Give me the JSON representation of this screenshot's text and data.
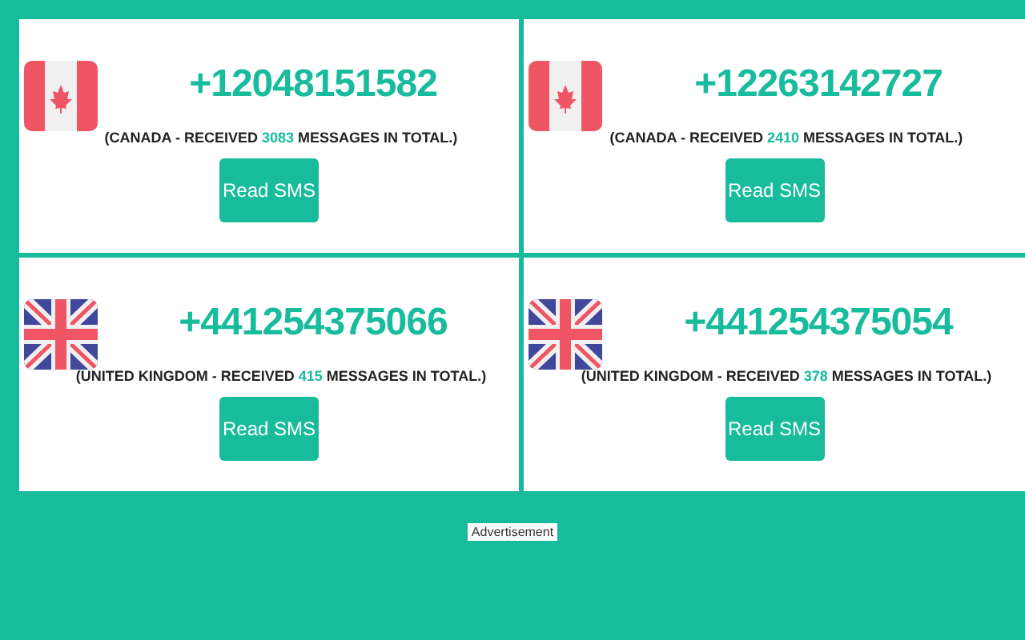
{
  "numbers": [
    {
      "kind": "ca",
      "phone": "+12048151582",
      "prefix": "(CANADA - RECEIVED ",
      "count": "3083",
      "suffix": " MESSAGES IN TOTAL.)",
      "button": "Read SMS"
    },
    {
      "kind": "ca",
      "phone": "+12263142727",
      "prefix": "(CANADA - RECEIVED ",
      "count": "2410",
      "suffix": " MESSAGES IN TOTAL.)",
      "button": "Read SMS"
    },
    {
      "kind": "gb",
      "phone": "+441254375066",
      "prefix": "(UNITED KINGDOM - RECEIVED ",
      "count": "415",
      "suffix": " MESSAGES IN TOTAL.)",
      "button": "Read SMS"
    },
    {
      "kind": "gb",
      "phone": "+441254375054",
      "prefix": "(UNITED KINGDOM - RECEIVED ",
      "count": "378",
      "suffix": " MESSAGES IN TOTAL.)",
      "button": "Read SMS"
    }
  ],
  "advertisement": "Advertisement"
}
